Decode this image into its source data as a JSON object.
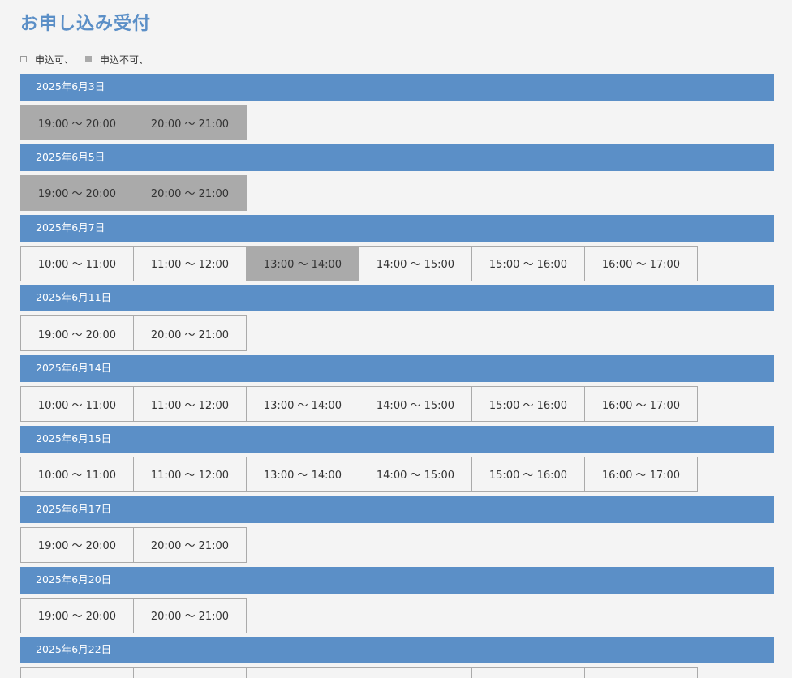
{
  "page": {
    "title": "お申し込み受付"
  },
  "legend": {
    "available_label": "申込可、",
    "unavailable_label": "申込不可、"
  },
  "colors": {
    "accent": "#5b8fc7",
    "unavailable": "#aaaaaa",
    "background": "#f4f4f4"
  },
  "days": [
    {
      "date": "2025年6月3日",
      "slots": [
        {
          "label": "19:00 ～ 20:00",
          "available": false
        },
        {
          "label": "20:00 ～ 21:00",
          "available": false
        }
      ]
    },
    {
      "date": "2025年6月5日",
      "slots": [
        {
          "label": "19:00 ～ 20:00",
          "available": false
        },
        {
          "label": "20:00 ～ 21:00",
          "available": false
        }
      ]
    },
    {
      "date": "2025年6月7日",
      "slots": [
        {
          "label": "10:00 ～ 11:00",
          "available": true
        },
        {
          "label": "11:00 ～ 12:00",
          "available": true
        },
        {
          "label": "13:00 ～ 14:00",
          "available": false
        },
        {
          "label": "14:00 ～ 15:00",
          "available": true
        },
        {
          "label": "15:00 ～ 16:00",
          "available": true
        },
        {
          "label": "16:00 ～ 17:00",
          "available": true
        }
      ]
    },
    {
      "date": "2025年6月11日",
      "slots": [
        {
          "label": "19:00 ～ 20:00",
          "available": true
        },
        {
          "label": "20:00 ～ 21:00",
          "available": true
        }
      ]
    },
    {
      "date": "2025年6月14日",
      "slots": [
        {
          "label": "10:00 ～ 11:00",
          "available": true
        },
        {
          "label": "11:00 ～ 12:00",
          "available": true
        },
        {
          "label": "13:00 ～ 14:00",
          "available": true
        },
        {
          "label": "14:00 ～ 15:00",
          "available": true
        },
        {
          "label": "15:00 ～ 16:00",
          "available": true
        },
        {
          "label": "16:00 ～ 17:00",
          "available": true
        }
      ]
    },
    {
      "date": "2025年6月15日",
      "slots": [
        {
          "label": "10:00 ～ 11:00",
          "available": true
        },
        {
          "label": "11:00 ～ 12:00",
          "available": true
        },
        {
          "label": "13:00 ～ 14:00",
          "available": true
        },
        {
          "label": "14:00 ～ 15:00",
          "available": true
        },
        {
          "label": "15:00 ～ 16:00",
          "available": true
        },
        {
          "label": "16:00 ～ 17:00",
          "available": true
        }
      ]
    },
    {
      "date": "2025年6月17日",
      "slots": [
        {
          "label": "19:00 ～ 20:00",
          "available": true
        },
        {
          "label": "20:00 ～ 21:00",
          "available": true
        }
      ]
    },
    {
      "date": "2025年6月20日",
      "slots": [
        {
          "label": "19:00 ～ 20:00",
          "available": true
        },
        {
          "label": "20:00 ～ 21:00",
          "available": true
        }
      ]
    },
    {
      "date": "2025年6月22日",
      "slots": [
        {
          "label": "",
          "available": true
        },
        {
          "label": "",
          "available": true
        },
        {
          "label": "",
          "available": true
        },
        {
          "label": "",
          "available": true
        },
        {
          "label": "",
          "available": true
        },
        {
          "label": "",
          "available": true
        }
      ]
    }
  ]
}
